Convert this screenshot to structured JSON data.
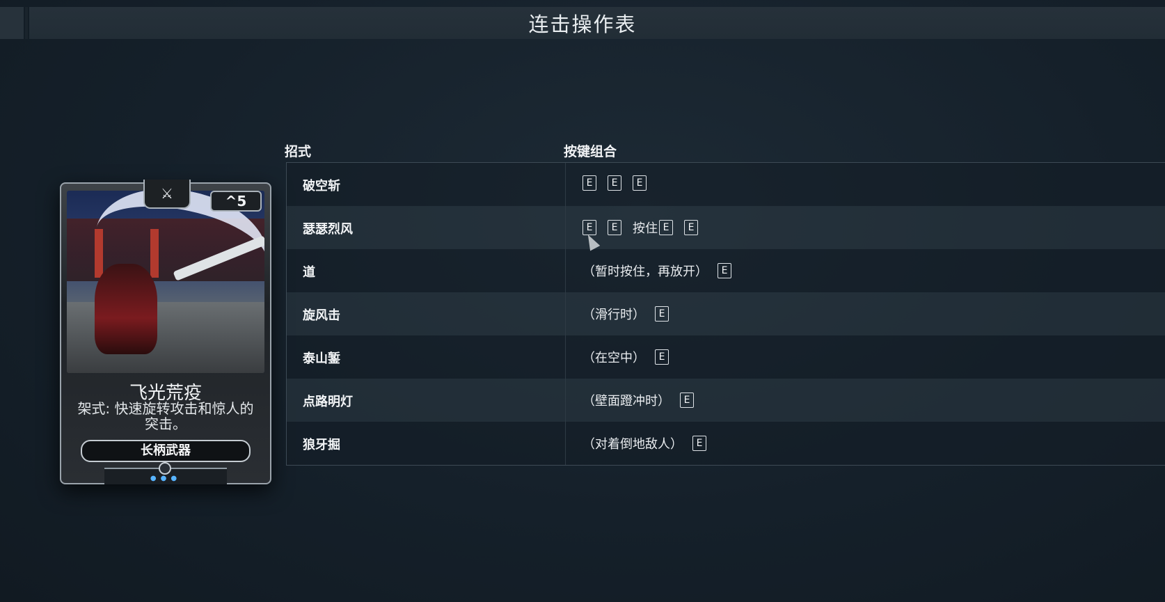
{
  "screen": {
    "title": "连击操作表"
  },
  "card": {
    "polarity_symbol": "⚔",
    "rank": "^5",
    "name": "飞光荒疫",
    "description": "架式: 快速旋转攻击和惊人的突击。",
    "type": "长柄武器"
  },
  "table": {
    "col_move": "招式",
    "col_keys": "按键组合",
    "rows": [
      {
        "name": "破空斩",
        "prefix": "",
        "keys": [
          "E",
          "E",
          "E"
        ],
        "hold_label": "",
        "hold_keys": []
      },
      {
        "name": "瑟瑟烈风",
        "prefix": "",
        "keys": [
          "E",
          "E"
        ],
        "hold_label": "按住",
        "hold_keys": [
          "E",
          "E"
        ]
      },
      {
        "name": "道",
        "prefix": "（暂时按住，再放开）",
        "keys": [
          "E"
        ],
        "hold_label": "",
        "hold_keys": []
      },
      {
        "name": "旋风击",
        "prefix": "（滑行时）",
        "keys": [
          "E"
        ],
        "hold_label": "",
        "hold_keys": []
      },
      {
        "name": "泰山錾",
        "prefix": "（在空中）",
        "keys": [
          "E"
        ],
        "hold_label": "",
        "hold_keys": []
      },
      {
        "name": "点路明灯",
        "prefix": "（壁面蹬冲时）",
        "keys": [
          "E"
        ],
        "hold_label": "",
        "hold_keys": []
      },
      {
        "name": "狼牙掘",
        "prefix": "（对着倒地敌人）",
        "keys": [
          "E"
        ],
        "hold_label": "",
        "hold_keys": []
      }
    ]
  },
  "colors": {
    "background": "#15202a",
    "accent_blue": "#58b4ff"
  }
}
